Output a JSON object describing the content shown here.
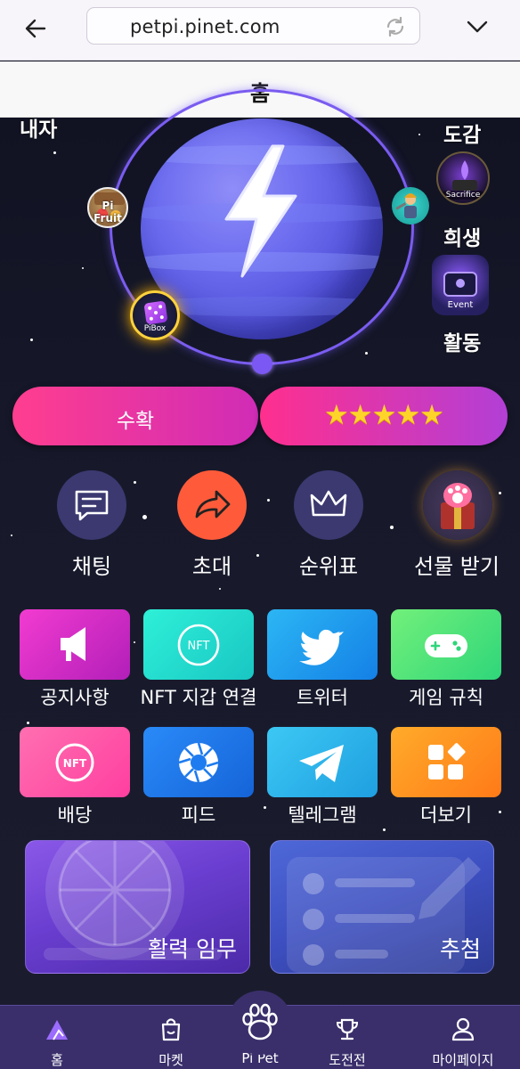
{
  "browser": {
    "url": "petpi.pinet.com"
  },
  "page": {
    "title": "홈"
  },
  "hero": {
    "corner_labels": {
      "top_left": "내자",
      "collection": "도감",
      "sacrifice": "희생",
      "activity": "활동"
    },
    "orbit_items": {
      "fruit": "Pi Fruit",
      "pibox": "PiBox",
      "sacrifice": "Sacrifice",
      "event": "Event"
    }
  },
  "actions": {
    "harvest_label": "수확",
    "rating_stars": "★★★★★",
    "rating_value": 5
  },
  "round_buttons": [
    {
      "label": "채팅",
      "icon": "chat-icon"
    },
    {
      "label": "초대",
      "icon": "share-arrow-icon"
    },
    {
      "label": "순위표",
      "icon": "crown-icon"
    },
    {
      "label": "선물 받기",
      "icon": "gift-box-icon"
    }
  ],
  "tiles": [
    {
      "label": "공지사항",
      "icon": "megaphone-icon",
      "color": "#e532c8"
    },
    {
      "label": "NFT 지갑 연결",
      "icon": "nft-icon",
      "color": "#26e2cc"
    },
    {
      "label": "트위터",
      "icon": "twitter-icon",
      "color": "#1d9bf0"
    },
    {
      "label": "게임 규칙",
      "icon": "gamepad-icon",
      "color": "#5ee862"
    },
    {
      "label": "배당",
      "icon": "nft-coin-icon",
      "color": "#ff5aa8"
    },
    {
      "label": "피드",
      "icon": "aperture-icon",
      "color": "#1e7cf0"
    },
    {
      "label": "텔레그램",
      "icon": "telegram-icon",
      "color": "#2db2ea"
    },
    {
      "label": "더보기",
      "icon": "grid-more-icon",
      "color": "#ff8a1e"
    }
  ],
  "nft_badge_text": "NFT",
  "cards": [
    {
      "label": "활력 임무",
      "icon": "wheel-icon"
    },
    {
      "label": "추첨",
      "icon": "checklist-icon"
    }
  ],
  "bottom_nav": [
    {
      "label": "홈",
      "icon": "home-icon",
      "active": true
    },
    {
      "label": "마켓",
      "icon": "shopping-bag-icon",
      "active": false
    },
    {
      "label": "Pi Pet",
      "icon": "paw-icon",
      "active": false
    },
    {
      "label": "도전전",
      "icon": "trophy-icon",
      "active": false
    },
    {
      "label": "마이페이지",
      "icon": "user-icon",
      "active": false
    }
  ],
  "colors": {
    "accent_purple": "#7b57f4",
    "pink": "#ff3e8f",
    "star_gold": "#ffd42a",
    "nav_bg": "#3a2f6b"
  }
}
